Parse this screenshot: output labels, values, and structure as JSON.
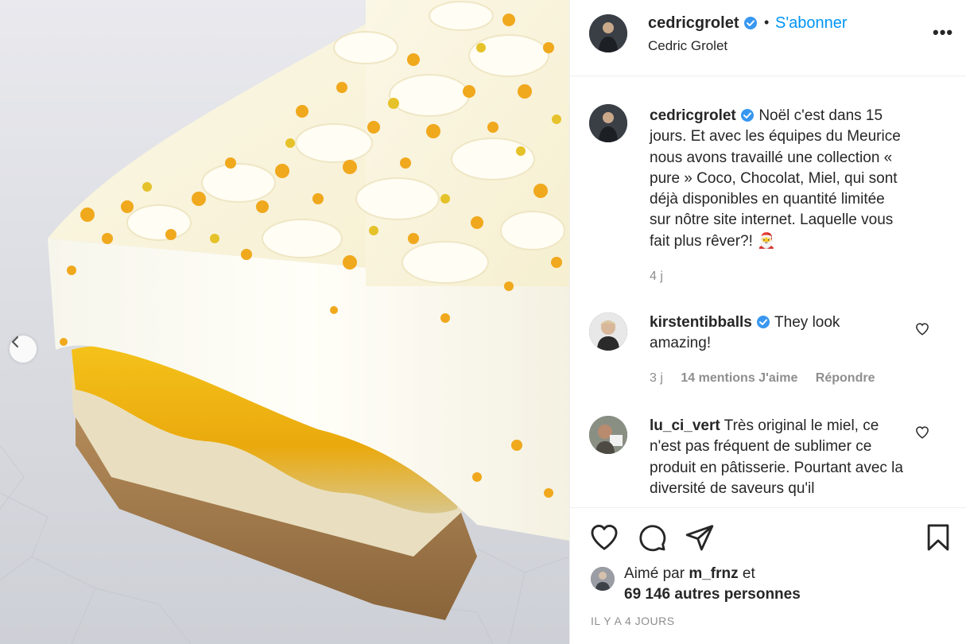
{
  "post": {
    "header": {
      "username": "cedricgrolet",
      "separator": "•",
      "follow_label": "S'abonner",
      "full_name": "Cedric Grolet",
      "more_icon": "more-horizontal-icon"
    },
    "caption": {
      "username": "cedricgrolet",
      "text": "Noël c'est dans 15 jours. Et avec les équipes du Meurice nous avons travaillé une collection « pure » Coco, Chocolat, Miel, qui sont déjà disponibles en quantité limitée sur nôtre site internet. Laquelle vous fait plus rêver?! 🎅",
      "time": "4 j"
    },
    "comments": [
      {
        "username": "kirstentibballs",
        "verified": true,
        "text": "They look amazing!",
        "time": "3 j",
        "likes": "14 mentions J'aime",
        "reply_label": "Répondre"
      },
      {
        "username": "lu_ci_vert",
        "verified": false,
        "text": "Très original le miel, ce n'est pas fréquent de sublimer ce produit en pâtisserie. Pourtant avec la diversité de saveurs qu'il"
      }
    ],
    "likes": {
      "prefix": "Aimé par",
      "first_user": "m_frnz",
      "conjunction": "et",
      "others": "69 146 autres personnes"
    },
    "time_ago": "IL Y A 4 JOURS"
  },
  "colors": {
    "link_blue": "#0095f6",
    "verified_blue": "#3897f0",
    "muted": "#8e8e8e",
    "text": "#262626"
  }
}
